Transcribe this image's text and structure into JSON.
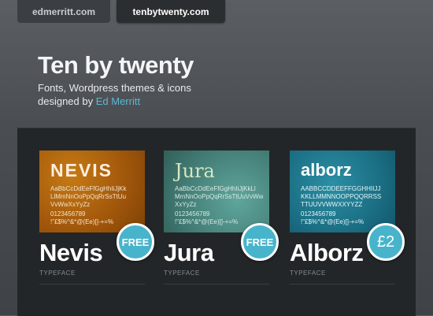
{
  "tabs": [
    {
      "label": "edmerritt.com",
      "active": false
    },
    {
      "label": "tenbytwenty.com",
      "active": true
    }
  ],
  "header": {
    "title": "Ten by twenty",
    "subtitle_line1": "Fonts, Wordpress themes & icons",
    "subtitle_line2_prefix": "designed by ",
    "author": "Ed Merritt"
  },
  "colors": {
    "accent": "#59b9d1",
    "badge": "#48b4cb",
    "panel": "#232628",
    "nevis_sample": "#a0560a",
    "jura_sample": "#437d76",
    "alborz_sample": "#1b6f84"
  },
  "fonts": [
    {
      "name": "Nevis",
      "type": "TYPEFACE",
      "badge": "FREE",
      "sample_title": "NEVIS",
      "sample_lines": [
        "AaBbCcDdEeFfGgHhIiJjKk",
        "LlMmNnOoPpQqRrSsTtUu",
        "VvWwXxYyZz"
      ],
      "sample_numbers": [
        "0123456789",
        "!\"£$%^&*@(Ee)[]-+=%"
      ]
    },
    {
      "name": "Jura",
      "type": "TYPEFACE",
      "badge": "FREE",
      "sample_title": "Jura",
      "sample_lines": [
        "AaBbCcDdEeFfGgHhIiJjKkLl",
        "MmNnOoPpQqRrSsTtUuVvWw",
        "XxYyZz"
      ],
      "sample_numbers": [
        "0123456789",
        "!\"£$%^&*@(Ee)[]-+=%"
      ]
    },
    {
      "name": "Alborz",
      "type": "TYPEFACE",
      "badge": "£2",
      "sample_title": "alborz",
      "sample_lines": [
        "AABBCCDDEEFFGGHHIIJJ",
        "KKLLMMNNOOPPQQRRSS",
        "TTUUVVWWXXYYZZ"
      ],
      "sample_numbers": [
        "0123456789",
        "!\"£$%^&*@(Ee)[]-+=%"
      ]
    }
  ]
}
